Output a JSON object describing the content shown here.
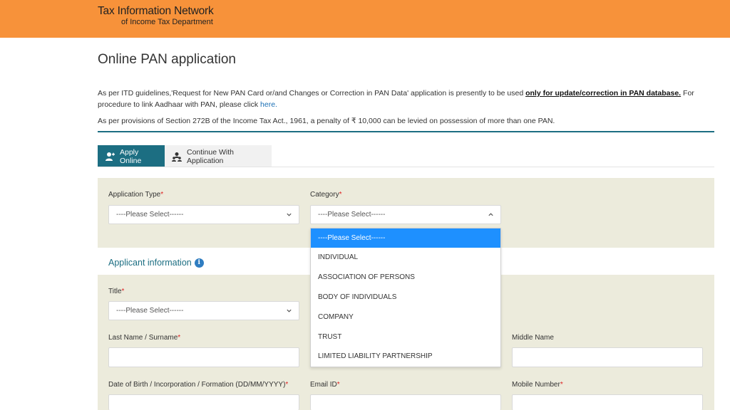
{
  "header": {
    "brand_line1": "Tax Information Network",
    "brand_line2": "of Income Tax Department",
    "bg_color": "#f7923a"
  },
  "page": {
    "title": "Online PAN application",
    "info1_pre": "As per ITD guidelines,'Request for New PAN Card or/and Changes or Correction in PAN Data' application is presently to be used ",
    "info1_bold": "only for update/correction in PAN database.",
    "info1_post": " For procedure to link Aadhaar with PAN, please click ",
    "info1_link": "here.",
    "info2": "As per provisions of Section 272B of the Income Tax Act., 1961, a penalty of ₹ 10,000 can be levied on possession of more than one PAN."
  },
  "tabs": [
    {
      "label": "Apply Online",
      "icon": "user-plus-icon",
      "active": true
    },
    {
      "label": "Continue With Application",
      "icon": "users-icon",
      "active": false
    }
  ],
  "form": {
    "application_type": {
      "label": "Application Type",
      "required": "*",
      "value": "----Please Select------"
    },
    "category": {
      "label": "Category",
      "required": "*",
      "value": "----Please Select------"
    },
    "applicant_section": "Applicant information",
    "title": {
      "label": "Title",
      "required": "*",
      "value": "----Please Select------"
    },
    "last_name": {
      "label": "Last Name / Surname",
      "required": "*",
      "value": ""
    },
    "middle_name": {
      "label": "Middle Name",
      "value": ""
    },
    "dob": {
      "label": "Date of Birth / Incorporation / Formation (DD/MM/YYYY)",
      "required": "*",
      "value": ""
    },
    "email": {
      "label": "Email ID",
      "required": "*",
      "value": ""
    },
    "mobile": {
      "label": "Mobile Number",
      "required": "*",
      "value": ""
    }
  },
  "category_dropdown": {
    "options": [
      "----Please Select------",
      "INDIVIDUAL",
      "ASSOCIATION OF PERSONS",
      "BODY OF INDIVIDUALS",
      "COMPANY",
      "TRUST",
      "LIMITED LIABILITY PARTNERSHIP"
    ],
    "selected_index": 0,
    "highlight_color": "#1e90ff"
  },
  "colors": {
    "accent": "#1c6e82",
    "panel": "#ecebdc"
  }
}
